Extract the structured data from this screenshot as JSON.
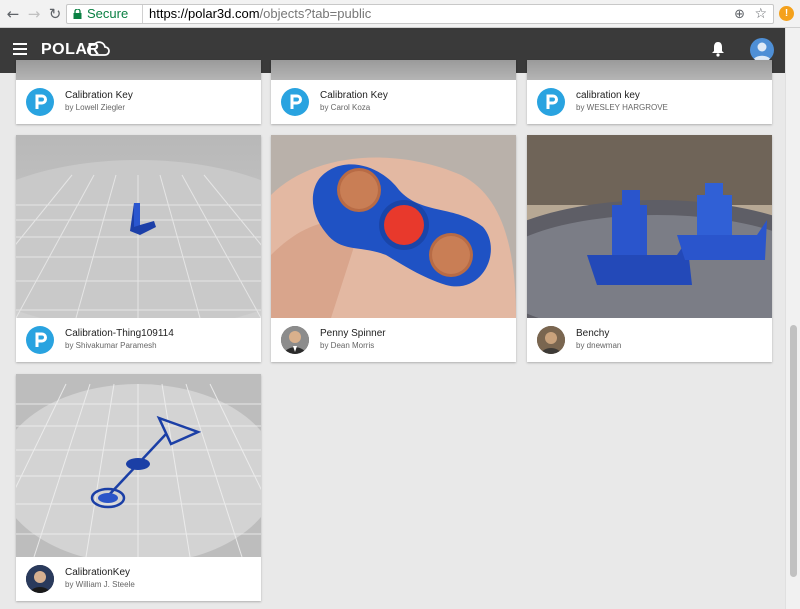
{
  "browser": {
    "secure_label": "Secure",
    "url_host": "https://polar3d.com",
    "url_path": "/objects?tab=public",
    "ext_badge": "!"
  },
  "header": {
    "logo_text": "POLAR",
    "icons": [
      "menu-icon",
      "cloud-icon",
      "bell-icon",
      "user-icon"
    ]
  },
  "colors": {
    "header_bg": "#3a3a3a",
    "accent_blue": "#29a3e0",
    "secure_green": "#0b8043"
  },
  "objects": [
    {
      "title": "Calibration Key",
      "author": "by Lowell Ziegler"
    },
    {
      "title": "Calibration Key",
      "author": "by Carol Koza"
    },
    {
      "title": "calibration key",
      "author": "by WESLEY HARGROVE"
    },
    {
      "title": "Calibration-Thing109114",
      "author": "by Shivakumar Paramesh"
    },
    {
      "title": "Penny Spinner",
      "author": "by Dean Morris"
    },
    {
      "title": "Benchy",
      "author": "by dnewman"
    },
    {
      "title": "CalibrationKey",
      "author": "by William J. Steele"
    }
  ]
}
